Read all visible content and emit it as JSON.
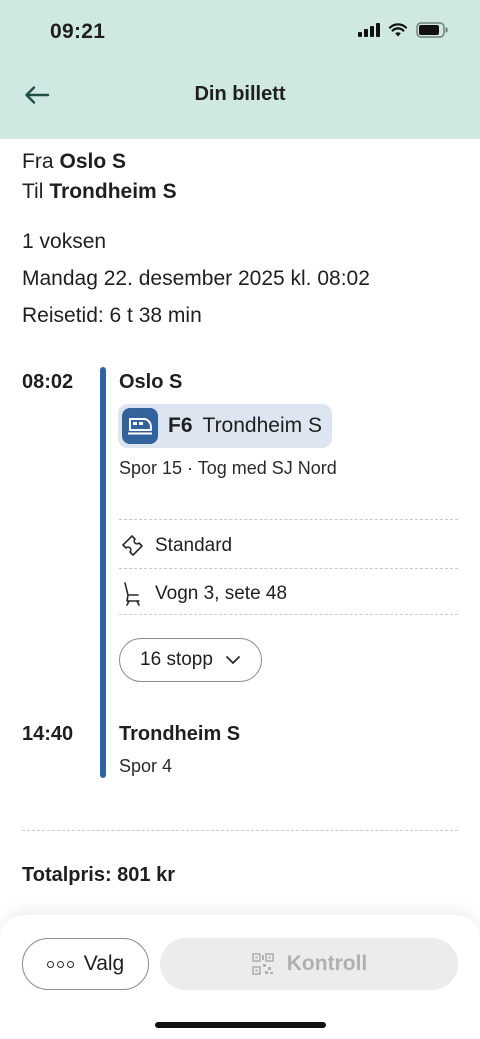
{
  "status_bar": {
    "time": "09:21"
  },
  "nav": {
    "title": "Din billett"
  },
  "route": {
    "from_label": "Fra",
    "from": "Oslo S",
    "to_label": "Til",
    "to": "Trondheim S"
  },
  "trip": {
    "passengers": "1 voksen",
    "datetime": "Mandag 22. desember 2025 kl. 08:02",
    "duration": "Reisetid: 6 t 38 min"
  },
  "departure": {
    "time": "08:02",
    "station": "Oslo S",
    "line_code": "F6",
    "destination": "Trondheim S",
    "platform_operator": "Spor 15 · Tog med SJ Nord",
    "ticket_class": "Standard",
    "seat": "Vogn 3, sete 48",
    "stops_label": "16 stopp"
  },
  "arrival": {
    "time": "14:40",
    "station": "Trondheim S",
    "platform": "Spor 4"
  },
  "total": {
    "label": "Totalpris: 801 kr"
  },
  "actions": {
    "valg_label": "Valg",
    "kontroll_label": "Kontroll"
  },
  "colors": {
    "header_bg": "#cfe9e2",
    "accent": "#33629c",
    "chip_bg": "#dde5f0"
  }
}
